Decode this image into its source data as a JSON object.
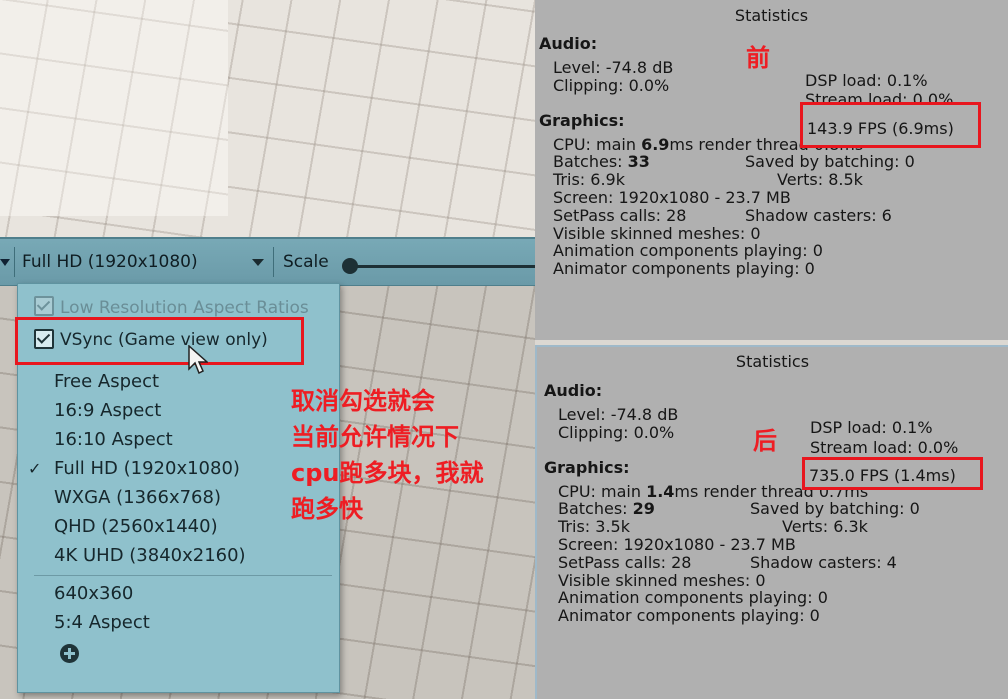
{
  "toolbar": {
    "resolution_value": "Full HD (1920x1080)",
    "scale_label": "Scale"
  },
  "menu": {
    "low_res_label": "Low Resolution Aspect Ratios",
    "vsync_label": "VSync (Game view only)",
    "items": [
      {
        "label": "Free Aspect",
        "selected": false
      },
      {
        "label": "16:9 Aspect",
        "selected": false
      },
      {
        "label": "16:10 Aspect",
        "selected": false
      },
      {
        "label": "Full HD (1920x1080)",
        "selected": true
      },
      {
        "label": "WXGA (1366x768)",
        "selected": false
      },
      {
        "label": "QHD (2560x1440)",
        "selected": false
      },
      {
        "label": "4K UHD (3840x2160)",
        "selected": false
      }
    ],
    "custom_items": [
      {
        "label": "640x360"
      },
      {
        "label": "5:4 Aspect"
      }
    ],
    "check_mark": "✓"
  },
  "annotation": {
    "lines": [
      "取消勾选就会",
      "当前允许情况下",
      "cpu跑多块，我就",
      "跑多快"
    ],
    "color": "#ee1d23"
  },
  "before": {
    "tag": "前",
    "title": "Statistics",
    "audio_header": "Audio:",
    "level": "Level: -74.8 dB",
    "clipping": "Clipping: 0.0%",
    "dsp_load": "DSP load: 0.1%",
    "stream_load": "Stream load: 0.0%",
    "graphics_header": "Graphics:",
    "fps": "143.9 FPS (6.9ms)",
    "cpu_prefix": "CPU: main ",
    "cpu_main": "6.9",
    "cpu_suffix": "ms  render thread 0.8ms",
    "batches_label": "Batches: ",
    "batches": "33",
    "saved_batching": "Saved by batching: 0",
    "tris": "Tris: 6.9k",
    "verts": "Verts: 8.5k",
    "screen": "Screen: 1920x1080 - 23.7 MB",
    "setpass": "SetPass calls: 28",
    "shadow_casters": "Shadow casters: 6",
    "skinned": "Visible skinned meshes: 0",
    "animation": "Animation components playing: 0",
    "animator": "Animator components playing: 0"
  },
  "after": {
    "tag": "后",
    "title": "Statistics",
    "audio_header": "Audio:",
    "level": "Level: -74.8 dB",
    "clipping": "Clipping: 0.0%",
    "dsp_load": "DSP load: 0.1%",
    "stream_load": "Stream load: 0.0%",
    "graphics_header": "Graphics:",
    "fps": "735.0 FPS (1.4ms)",
    "cpu_prefix": "CPU: main ",
    "cpu_main": "1.4",
    "cpu_suffix": "ms  render thread 0.7ms",
    "batches_label": "Batches: ",
    "batches": "29",
    "saved_batching": "Saved by batching: 0",
    "tris": "Tris: 3.5k",
    "verts": "Verts: 6.3k",
    "screen": "Screen: 1920x1080 - 23.7 MB",
    "setpass": "SetPass calls: 28",
    "shadow_casters": "Shadow casters: 4",
    "skinned": "Visible skinned meshes: 0",
    "animation": "Animation components playing: 0",
    "animator": "Animator components playing: 0"
  }
}
